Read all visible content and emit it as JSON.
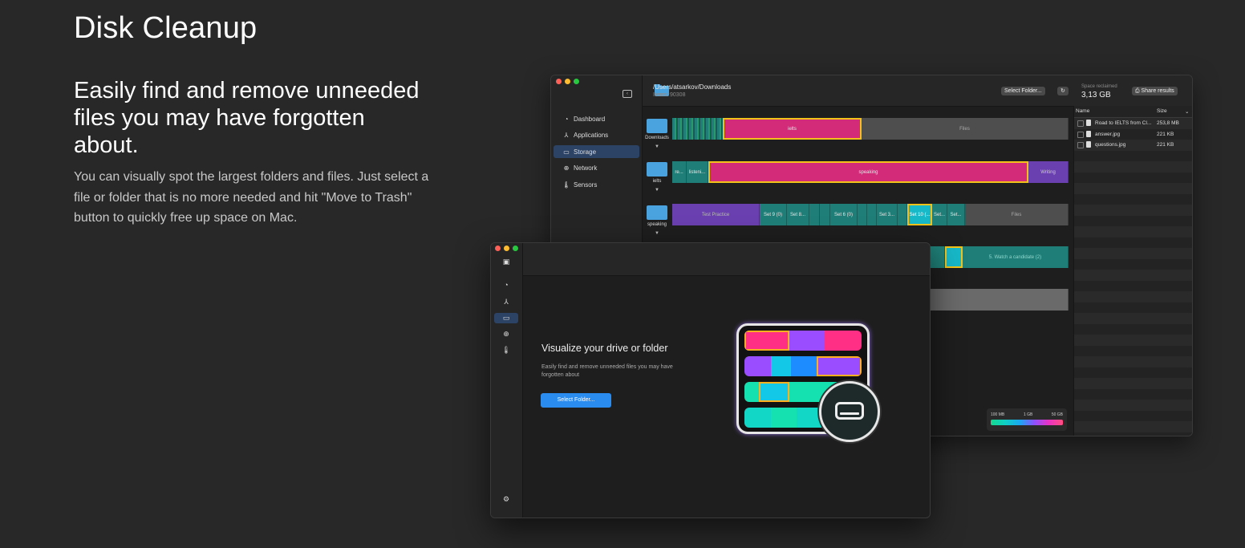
{
  "hero": {
    "title": "Disk Cleanup",
    "subtitle": "Easily find and remove unneeded files you may have forgotten about.",
    "description": "You can visually spot the largest folders and files. Just select a file or folder that is no more needed and hit \"Move to Trash\" button to quickly free up space on Mac."
  },
  "back_window": {
    "sidebar": [
      {
        "label": "Dashboard",
        "icon": "gauge-icon",
        "glyph": "◔"
      },
      {
        "label": "Applications",
        "icon": "applications-icon",
        "glyph": "⅄"
      },
      {
        "label": "Storage",
        "icon": "drive-icon",
        "glyph": "▭"
      },
      {
        "label": "Network",
        "icon": "globe-icon",
        "glyph": "⊕"
      },
      {
        "label": "Sensors",
        "icon": "thermometer-icon",
        "glyph": "🌡"
      }
    ],
    "path": "/Users/atsarkov/Downloads",
    "items": "Items: 90308",
    "select_folder": "Select Folder...",
    "refresh_glyph": "↻",
    "space_reclaimed_label": "Space reclaimed",
    "space_reclaimed_value": "3,13 GB",
    "share_results": "⎙ Share results",
    "table": {
      "col_name": "Name",
      "col_size": "Size",
      "rows": [
        {
          "name": "Road to IELTS from Cl...",
          "size": "253,8 MB"
        },
        {
          "name": "answer.jpg",
          "size": "221 KB"
        },
        {
          "name": "questions.jpg",
          "size": "221 KB"
        }
      ]
    },
    "folders": [
      {
        "label": "Downloads"
      },
      {
        "label": "ielts"
      },
      {
        "label": "speaking"
      }
    ],
    "bars": {
      "row1": {
        "ielts": "ielts",
        "files": "Files"
      },
      "row2": {
        "a": "re...",
        "b": "listeni...",
        "speaking": "speaking",
        "writing": "Writing"
      },
      "row3": {
        "test_practice": "Test Practice",
        "s9": "Set 9 (0)",
        "s8": "Set 8...",
        "s6": "Set 6 (0)",
        "s3": "Set 3...",
        "s10": "Set 10 (...",
        "sx": "Set...",
        "sy": "Set...",
        "files": "Files"
      },
      "row4": {
        "watch": "5. Watch a candidate (2)"
      }
    },
    "legend": {
      "l1": "100 MB",
      "l2": "1 GB",
      "l3": "50 GB"
    }
  },
  "front_window": {
    "title": "Visualize your drive or folder",
    "description": "Easily find and remove unneeded files you may have forgotten about",
    "button": "Select Folder...",
    "toggle_glyph": "▣",
    "icons": [
      {
        "name": "gauge-icon",
        "glyph": "◔"
      },
      {
        "name": "applications-icon",
        "glyph": "⅄"
      },
      {
        "name": "drive-icon",
        "glyph": "▭"
      },
      {
        "name": "globe-icon",
        "glyph": "⊕"
      },
      {
        "name": "thermometer-icon",
        "glyph": "🌡"
      }
    ],
    "settings_glyph": "⚙"
  },
  "colors": {
    "pink": "#d42a7a",
    "purple": "#6a3fb0",
    "teal": "#1f7f78",
    "gray": "#4e4e4e",
    "accent_blue": "#2b8cf0",
    "selection": "#f3c21a"
  }
}
